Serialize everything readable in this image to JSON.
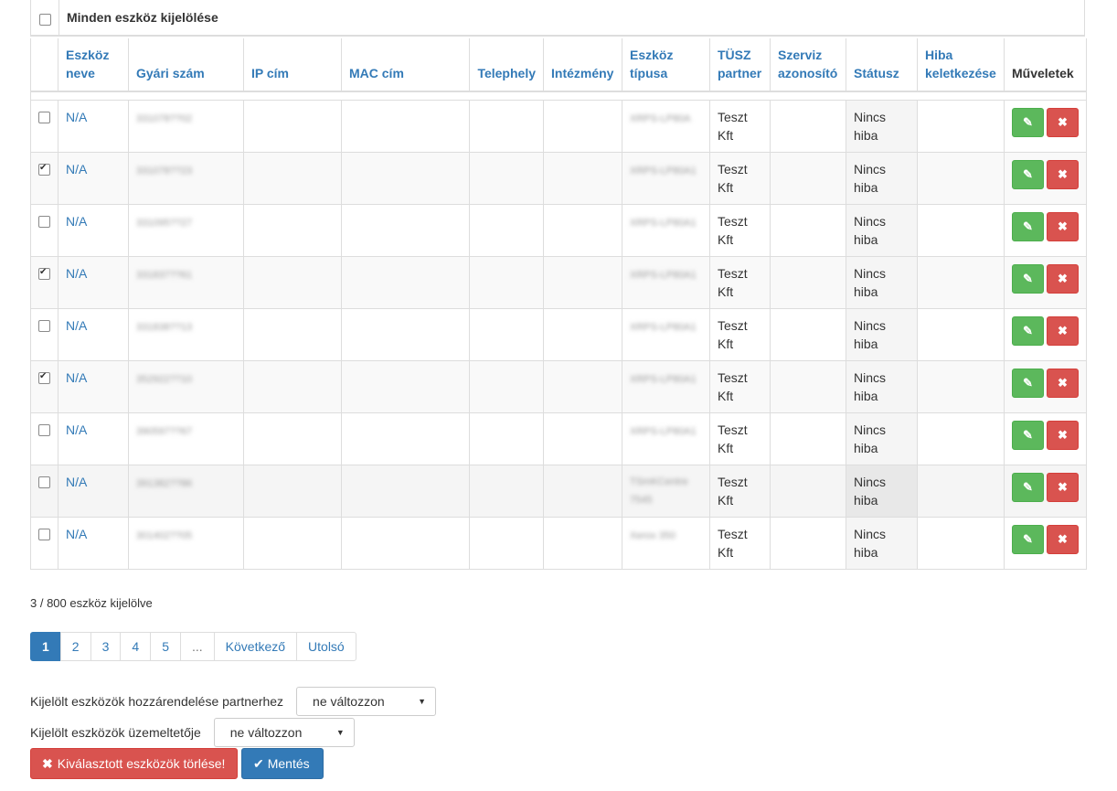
{
  "select_all": {
    "label": "Minden eszköz kijelölése",
    "checked": false
  },
  "columns": [
    {
      "label": "Eszköz neve",
      "sortable": true
    },
    {
      "label": "Gyári szám",
      "sortable": true
    },
    {
      "label": "IP cím",
      "sortable": true
    },
    {
      "label": "MAC cím",
      "sortable": true
    },
    {
      "label": "Telephely",
      "sortable": true
    },
    {
      "label": "Intézmény",
      "sortable": true
    },
    {
      "label": "Eszköz típusa",
      "sortable": true
    },
    {
      "label": "TÜSZ partner",
      "sortable": true
    },
    {
      "label": "Szerviz azonosító",
      "sortable": true
    },
    {
      "label": "Státusz",
      "sortable": true
    },
    {
      "label": "Hiba keletkezése",
      "sortable": true
    },
    {
      "label": "Műveletek",
      "sortable": false
    }
  ],
  "rows": [
    {
      "checked": false,
      "name": "N/A",
      "serial": "331078??02",
      "type": "XRPS-LP80A",
      "partner": "Teszt Kft",
      "status": "Nincs hiba"
    },
    {
      "checked": true,
      "name": "N/A",
      "serial": "331078??23",
      "type": "XRPS-LP80A1",
      "partner": "Teszt Kft",
      "status": "Nincs hiba"
    },
    {
      "checked": false,
      "name": "N/A",
      "serial": "331095??27",
      "type": "XRPS-LP80A1",
      "partner": "Teszt Kft",
      "status": "Nincs hiba"
    },
    {
      "checked": true,
      "name": "N/A",
      "serial": "331837??61",
      "type": "XRPS-LP80A1",
      "partner": "Teszt Kft",
      "status": "Nincs hiba"
    },
    {
      "checked": false,
      "name": "N/A",
      "serial": "331838??13",
      "type": "XRPS-LP80A1",
      "partner": "Teszt Kft",
      "status": "Nincs hiba"
    },
    {
      "checked": true,
      "name": "N/A",
      "serial": "352922??10",
      "type": "XRPS-LP80A1",
      "partner": "Teszt Kft",
      "status": "Nincs hiba"
    },
    {
      "checked": false,
      "name": "N/A",
      "serial": "390597??67",
      "type": "XRPS-LP80A1",
      "partner": "Teszt Kft",
      "status": "Nincs hiba"
    },
    {
      "checked": false,
      "name": "N/A",
      "serial": "391382??86",
      "type": "TSmKCentre 7545",
      "partner": "Teszt Kft",
      "status": "Nincs hiba",
      "hover": true
    },
    {
      "checked": false,
      "name": "N/A",
      "serial": "301402??05",
      "type": "Xerox 350",
      "partner": "Teszt Kft",
      "status": "Nincs hiba"
    }
  ],
  "selection_count": "3 / 800 eszköz kijelölve",
  "pagination": {
    "pages": [
      "1",
      "2",
      "3",
      "4",
      "5"
    ],
    "active": "1",
    "ellipsis": "...",
    "next": "Következő",
    "last": "Utolsó"
  },
  "assign_partner": {
    "label": "Kijelölt eszközök hozzárendelése partnerhez",
    "value": "ne változzon"
  },
  "operator": {
    "label": "Kijelölt eszközök üzemeltetője",
    "value": "ne változzon"
  },
  "buttons": {
    "delete_selected": "Kiválasztott eszközök törlése!",
    "save": "Mentés"
  },
  "colors": {
    "link": "#337ab7",
    "success": "#5cb85c",
    "danger": "#d9534f",
    "primary": "#337ab7"
  },
  "icons": {
    "edit": "pencil-icon",
    "delete": "times-icon",
    "save": "check-icon",
    "delete_selected": "times-icon",
    "select": "caret-down-icon"
  }
}
